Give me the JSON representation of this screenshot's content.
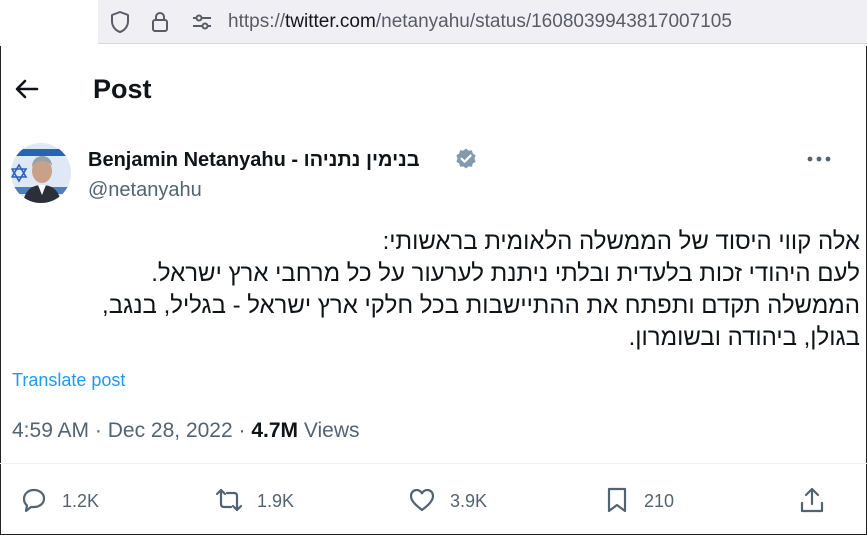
{
  "browser": {
    "url_prefix": "https://",
    "url_host": "twitter.com",
    "url_path": "/netanyahu/status/1608039943817007105"
  },
  "header": {
    "title": "Post"
  },
  "author": {
    "name": "Benjamin Netanyahu - בנימין נתניהו",
    "handle": "@netanyahu"
  },
  "tweet": {
    "lines": [
      "אלה קווי היסוד של הממשלה הלאומית בראשותי:",
      "לעם היהודי זכות בלעדית ובלתי ניתנת לערעור על כל מרחבי ארץ ישראל.",
      "הממשלה תקדם ותפתח את ההתיישבות בכל חלקי ארץ ישראל - בגליל, בנגב,",
      "בגולן, ביהודה ובשומרון."
    ],
    "translate_label": "Translate post"
  },
  "meta": {
    "time": "4:59 AM",
    "separator": " · ",
    "date": "Dec 28, 2022",
    "views_count": "4.7M",
    "views_label": " Views"
  },
  "actions": {
    "replies": "1.2K",
    "reposts": "1.9K",
    "likes": "3.9K",
    "bookmarks": "210"
  },
  "colors": {
    "accent": "#1d9bf0",
    "secondary_text": "#536471",
    "primary_text": "#0f1419"
  }
}
